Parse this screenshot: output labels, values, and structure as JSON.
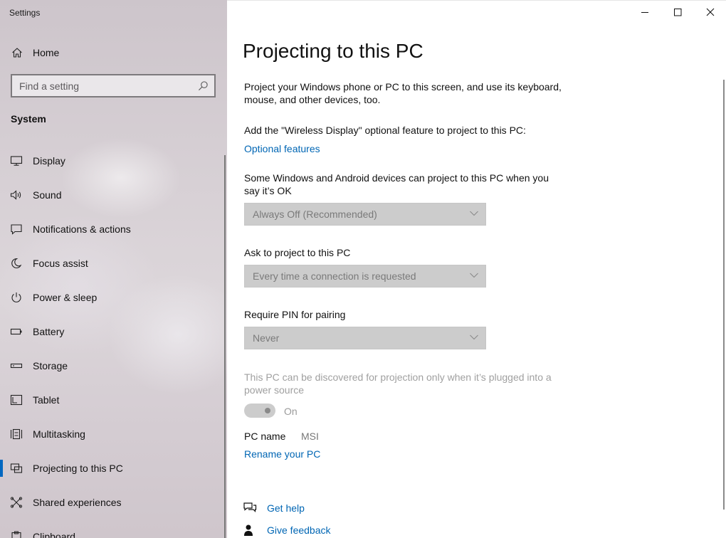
{
  "window": {
    "app_title": "Settings"
  },
  "sidebar": {
    "home_label": "Home",
    "search_placeholder": "Find a setting",
    "section_title": "System",
    "items": [
      {
        "label": "Display",
        "icon": "display-icon"
      },
      {
        "label": "Sound",
        "icon": "speaker-icon"
      },
      {
        "label": "Notifications & actions",
        "icon": "notification-icon"
      },
      {
        "label": "Focus assist",
        "icon": "moon-icon"
      },
      {
        "label": "Power & sleep",
        "icon": "power-icon"
      },
      {
        "label": "Battery",
        "icon": "battery-icon"
      },
      {
        "label": "Storage",
        "icon": "storage-icon"
      },
      {
        "label": "Tablet",
        "icon": "tablet-icon"
      },
      {
        "label": "Multitasking",
        "icon": "multitasking-icon"
      },
      {
        "label": "Projecting to this PC",
        "icon": "projecting-icon",
        "selected": true
      },
      {
        "label": "Shared experiences",
        "icon": "shared-experiences-icon"
      },
      {
        "label": "Clipboard",
        "icon": "clipboard-icon"
      }
    ]
  },
  "main": {
    "title": "Projecting to this PC",
    "description": "Project your Windows phone or PC to this screen, and use its keyboard, mouse, and other devices, too.",
    "wireless_text": "Add the \"Wireless Display\" optional feature to project to this PC:",
    "optional_features_link": "Optional features",
    "devices_text": "Some Windows and Android devices can project to this PC when you say it’s OK",
    "devices_dropdown_value": "Always Off (Recommended)",
    "ask_label": "Ask to project to this PC",
    "ask_dropdown_value": "Every time a connection is requested",
    "pin_label": "Require PIN for pairing",
    "pin_dropdown_value": "Never",
    "plugged_text": "This PC can be discovered for projection only when it’s plugged into a power source",
    "toggle_state_label": "On",
    "pc_name_label": "PC name",
    "pc_name_value": "MSI",
    "rename_link": "Rename your PC",
    "get_help_label": "Get help",
    "give_feedback_label": "Give feedback"
  },
  "colors": {
    "accent": "#0067c0",
    "link": "#0066b4",
    "disabled_dropdown": "#cccccc"
  }
}
